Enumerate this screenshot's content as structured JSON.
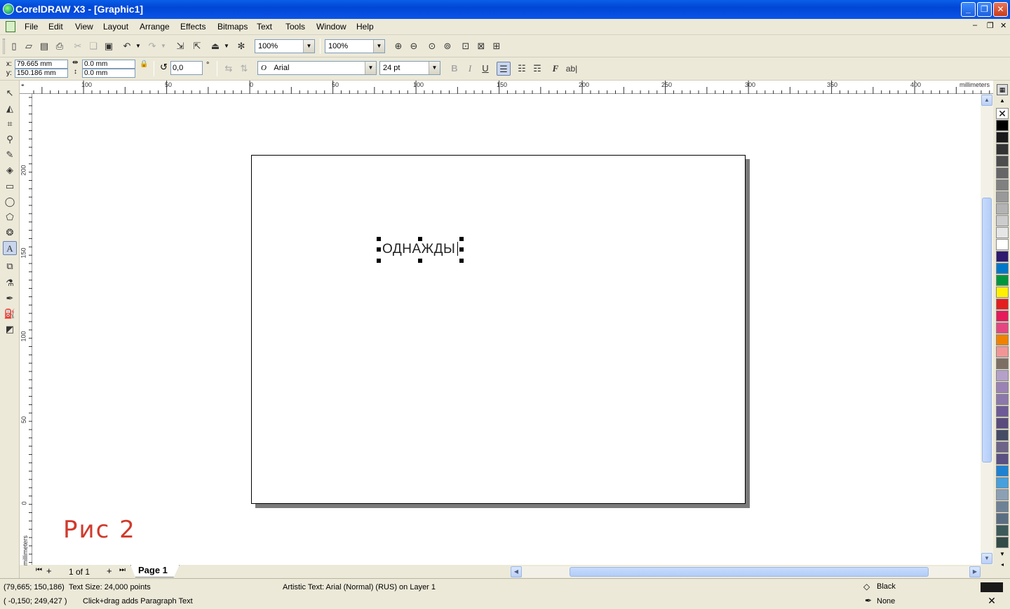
{
  "window": {
    "title": "CorelDRAW X3 - [Graphic1]",
    "minimize": "_",
    "maximize": "❐",
    "close": "✕"
  },
  "menu": [
    "File",
    "Edit",
    "View",
    "Layout",
    "Arrange",
    "Effects",
    "Bitmaps",
    "Text",
    "Tools",
    "Window",
    "Help"
  ],
  "toolbar": {
    "zoom1": "100%",
    "zoom2": "100%"
  },
  "propertybar": {
    "x_label": "x:",
    "x_value": "79.665 mm",
    "y_label": "y:",
    "y_value": "150.186 mm",
    "w_value": "0.0 mm",
    "h_value": "0.0 mm",
    "angle": "0,0",
    "degree": "°",
    "font": "Arial",
    "font_icon": "O",
    "font_size": "24 pt",
    "bold": "B",
    "italic": "I",
    "underline": "U",
    "format_text": "F",
    "edit_text": "ab|"
  },
  "rulers": {
    "units": "millimeters",
    "h_ticks": [
      "100",
      "50",
      "0",
      "50",
      "100",
      "150",
      "200",
      "250",
      "300",
      "350",
      "400"
    ],
    "v_ticks": [
      "200",
      "150",
      "100",
      "50",
      "0"
    ]
  },
  "canvas": {
    "text_object": "ОДНАЖДЫ",
    "annotation": "Рис 2"
  },
  "pagebar": {
    "counter": "1 of 1",
    "page_tab": "Page 1"
  },
  "palette": [
    "#000000",
    "#1a1a1a",
    "#333333",
    "#4d4d4d",
    "#666666",
    "#808080",
    "#999999",
    "#b3b3b3",
    "#cccccc",
    "#e6e6e6",
    "#ffffff",
    "#2e1a6e",
    "#0078c8",
    "#00963c",
    "#fff000",
    "#e41e1e",
    "#e6195a",
    "#e64680",
    "#f08200",
    "#f09696",
    "#7d6e64",
    "#b4a0c8",
    "#9b82b4",
    "#8c78aa",
    "#6e5a96",
    "#5a4b7d",
    "#464b64",
    "#6e6487",
    "#5a5082",
    "#1e82d2",
    "#46a0dc",
    "#8ca0b4",
    "#6e8296",
    "#5a6e82",
    "#3c5a5a",
    "#324b46"
  ],
  "status": {
    "coords": "(79,665; 150,186)",
    "text_size": "Text Size: 24,000 points",
    "object_info": "Artistic Text: Arial (Normal) (RUS) on Layer 1",
    "fill_label": "Black",
    "outline_label": "None",
    "cursor": "( -0,150; 249,427 )",
    "hint": "Click+drag adds Paragraph Text"
  }
}
